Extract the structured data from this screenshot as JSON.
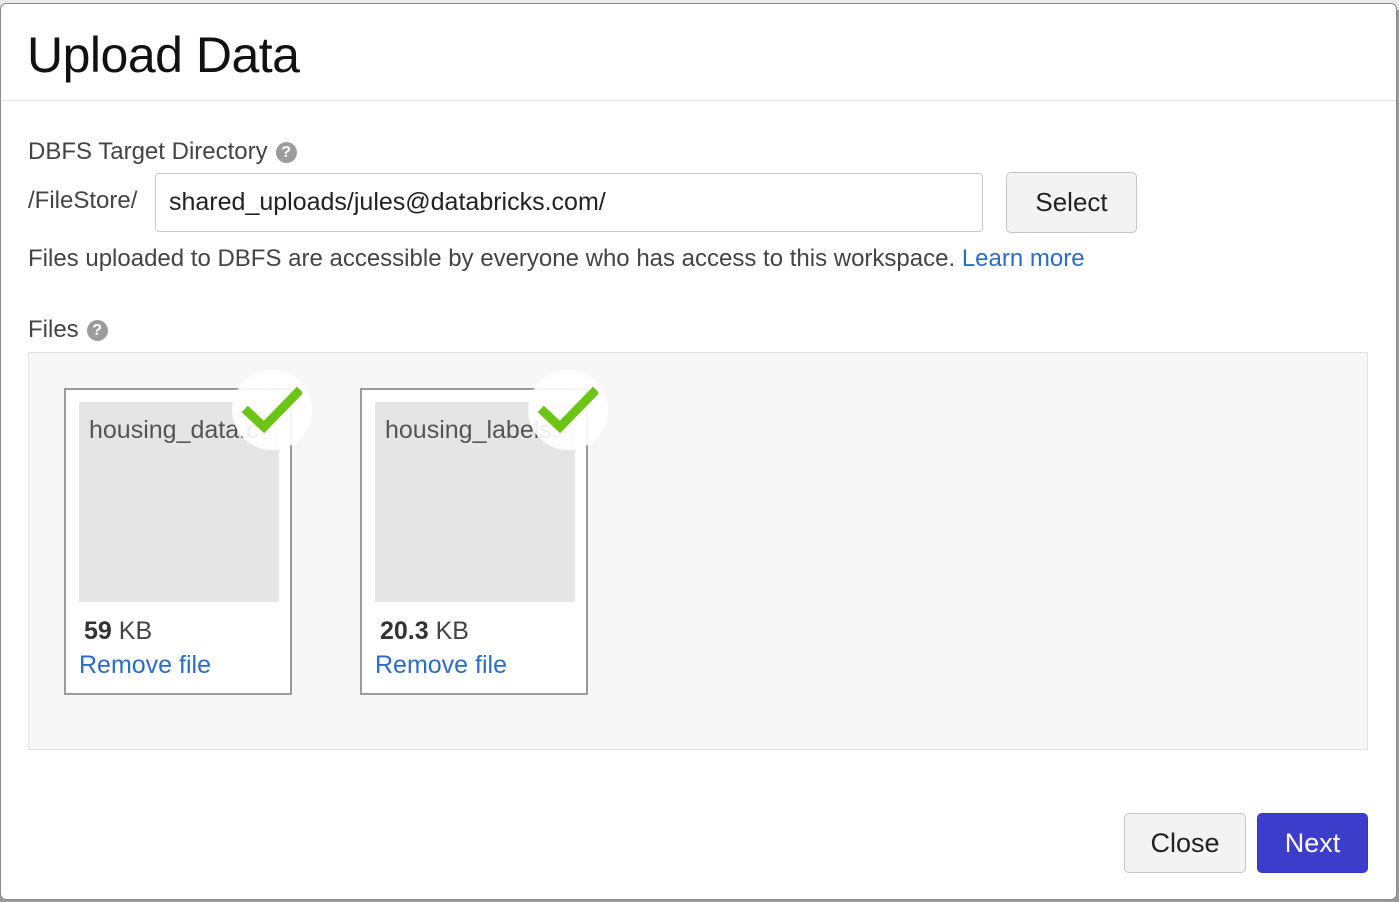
{
  "modal": {
    "title": "Upload Data"
  },
  "target": {
    "label": "DBFS Target Directory",
    "prefix": "/FileStore/",
    "path_value": "shared_uploads/jules@databricks.com/",
    "select_label": "Select",
    "info_text": "Files uploaded to DBFS are accessible by everyone who has access to this workspace.",
    "learn_more": "Learn more"
  },
  "files": {
    "label": "Files",
    "items": [
      {
        "name": "housing_data.c",
        "size_value": "59",
        "size_unit": "KB",
        "remove_label": "Remove file",
        "status": "uploaded"
      },
      {
        "name": "housing_labels.",
        "size_value": "20.3",
        "size_unit": "KB",
        "remove_label": "Remove file",
        "status": "uploaded"
      }
    ]
  },
  "footer": {
    "close_label": "Close",
    "next_label": "Next"
  },
  "icons": {
    "help": "help-circle-icon",
    "check": "check-icon"
  },
  "colors": {
    "primary": "#3d3dcc",
    "link": "#2c6cc4",
    "success": "#6cc417"
  }
}
